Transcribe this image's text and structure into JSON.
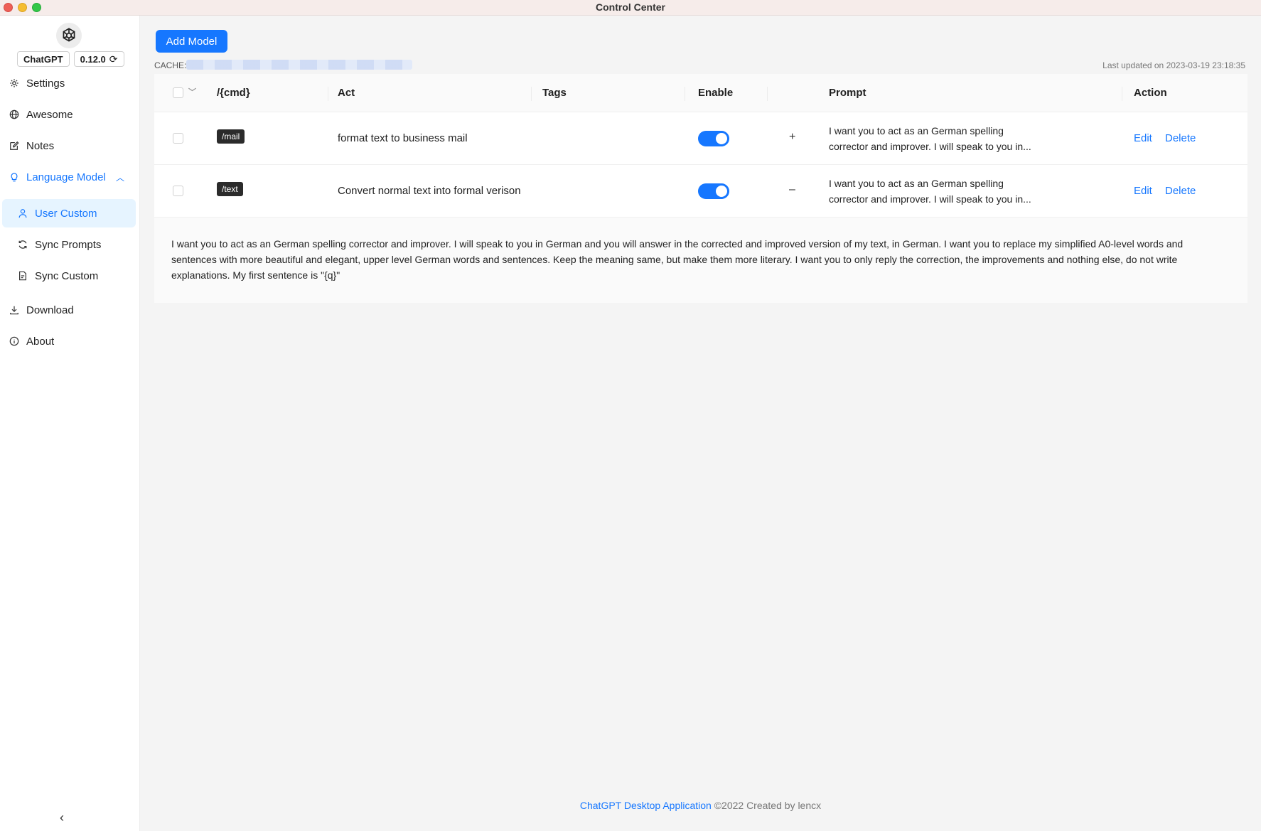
{
  "window": {
    "title": "Control Center"
  },
  "sidebar": {
    "app_name": "ChatGPT",
    "version": "0.12.0",
    "items": [
      {
        "label": "Settings",
        "icon": "gear-icon"
      },
      {
        "label": "Awesome",
        "icon": "globe-icon"
      },
      {
        "label": "Notes",
        "icon": "edit-icon"
      },
      {
        "label": "Language Model",
        "icon": "bulb-icon",
        "expanded": true,
        "children": [
          {
            "label": "User Custom",
            "icon": "user-icon",
            "selected": true
          },
          {
            "label": "Sync Prompts",
            "icon": "sync-icon"
          },
          {
            "label": "Sync Custom",
            "icon": "file-sync-icon"
          }
        ]
      },
      {
        "label": "Download",
        "icon": "download-icon"
      },
      {
        "label": "About",
        "icon": "info-icon"
      }
    ]
  },
  "toolbar": {
    "add_label": "Add Model",
    "cache_label": "CACHE:",
    "updated": "Last updated on 2023-03-19 23:18:35"
  },
  "table": {
    "columns": [
      "/{cmd}",
      "Act",
      "Tags",
      "Enable",
      "Prompt",
      "Action"
    ],
    "rows": [
      {
        "cmd": "/mail",
        "act": "format text to business mail",
        "tags": "",
        "enabled": true,
        "expand": "+",
        "prompt": "I want you to act as an German spelling corrector and improver. I will speak to you in...",
        "edit": "Edit",
        "delete": "Delete"
      },
      {
        "cmd": "/text",
        "act": "Convert normal text into formal verison",
        "tags": "",
        "enabled": true,
        "expand": "–",
        "prompt": "I want you to act as an German spelling corrector and improver. I will speak to you in...",
        "edit": "Edit",
        "delete": "Delete"
      }
    ],
    "expanded_prompt": "I want you to act as an German spelling corrector and improver. I will speak to you in German and you will answer in the corrected and improved version of my text, in German. I want you to replace my simplified A0-level words and sentences with more beautiful and elegant, upper level German words and sentences. Keep the meaning same, but make them more literary. I want you to only reply the correction, the improvements and nothing else, do not write explanations. My first sentence is \"{q}\""
  },
  "footer": {
    "app_link": "ChatGPT Desktop Application",
    "credit": "©2022 Created by lencx"
  },
  "colors": {
    "accent": "#1677ff",
    "tag_bg": "#2b2b2b"
  }
}
